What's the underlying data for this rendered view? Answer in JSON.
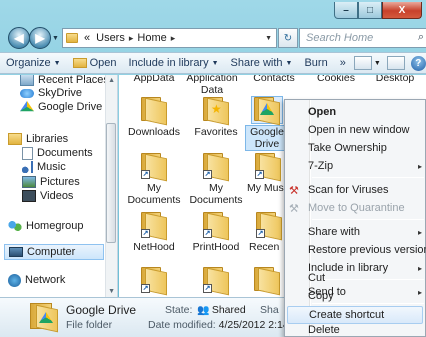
{
  "window": {
    "title_buttons": {
      "minimize": "–",
      "maximize": "□",
      "close": "X"
    }
  },
  "nav": {
    "back_icon": "left-arrow",
    "forward_icon": "right-arrow",
    "breadcrumb": {
      "prefix": "«",
      "crumbs": [
        "Users",
        "Home"
      ],
      "separator": "▸"
    },
    "refresh_label": "↻",
    "search_placeholder": "Search Home"
  },
  "toolbar": {
    "organize": "Organize",
    "open": "Open",
    "include_in_library": "Include in library",
    "share_with": "Share with",
    "burn": "Burn",
    "more": "»",
    "help": "?"
  },
  "nav_pane": {
    "items": [
      {
        "label": "Recent Places",
        "icon": "recent-places-icon"
      },
      {
        "label": "SkyDrive",
        "icon": "skydrive-icon"
      },
      {
        "label": "Google Drive",
        "icon": "google-drive-icon"
      },
      {
        "label": "Libraries",
        "icon": "libraries-icon"
      },
      {
        "label": "Documents",
        "icon": "documents-icon"
      },
      {
        "label": "Music",
        "icon": "music-icon"
      },
      {
        "label": "Pictures",
        "icon": "pictures-icon"
      },
      {
        "label": "Videos",
        "icon": "videos-icon"
      },
      {
        "label": "Homegroup",
        "icon": "homegroup-icon"
      },
      {
        "label": "Computer",
        "icon": "computer-icon"
      },
      {
        "label": "Network",
        "icon": "network-icon"
      }
    ]
  },
  "files": {
    "top_row": [
      "AppData",
      "Application Data",
      "Contacts",
      "Cookies",
      "Desktop"
    ],
    "row2": [
      "Downloads",
      "Favorites",
      "Google Drive"
    ],
    "row3": [
      "My Documents",
      "My Documents",
      "My Mus"
    ],
    "row4": [
      "NetHood",
      "PrintHood",
      "Recen"
    ],
    "shortcut_glyph": "↗"
  },
  "context_menu": {
    "items": [
      {
        "label": "Open",
        "bold": true
      },
      {
        "label": "Open in new window"
      },
      {
        "label": "Take Ownership"
      },
      {
        "label": "7-Zip",
        "submenu": true
      },
      {
        "label": "Scan for Viruses",
        "icon": "antivirus-icon"
      },
      {
        "label": "Move to Quarantine",
        "disabled": true,
        "icon": "quarantine-icon"
      },
      {
        "label": "Share with",
        "submenu": true
      },
      {
        "label": "Restore previous versions"
      },
      {
        "label": "Include in library",
        "submenu": true
      },
      {
        "label": "Send to",
        "submenu": true
      },
      {
        "label": "Cut"
      },
      {
        "label": "Copy"
      },
      {
        "label": "Create shortcut",
        "hover": true
      },
      {
        "label": "Delete"
      }
    ],
    "submenu_glyph": "▸"
  },
  "details": {
    "name": "Google Drive",
    "type": "File folder",
    "state_label": "State:",
    "state_value": "Shared",
    "modified_label": "Date modified:",
    "modified_value": "4/25/2012 2:14 PM",
    "extra": "Sha"
  },
  "colors": {
    "accent": "#2c8fa8",
    "selection": "#cde6fb",
    "menu_bg": "#f4f6f8"
  }
}
